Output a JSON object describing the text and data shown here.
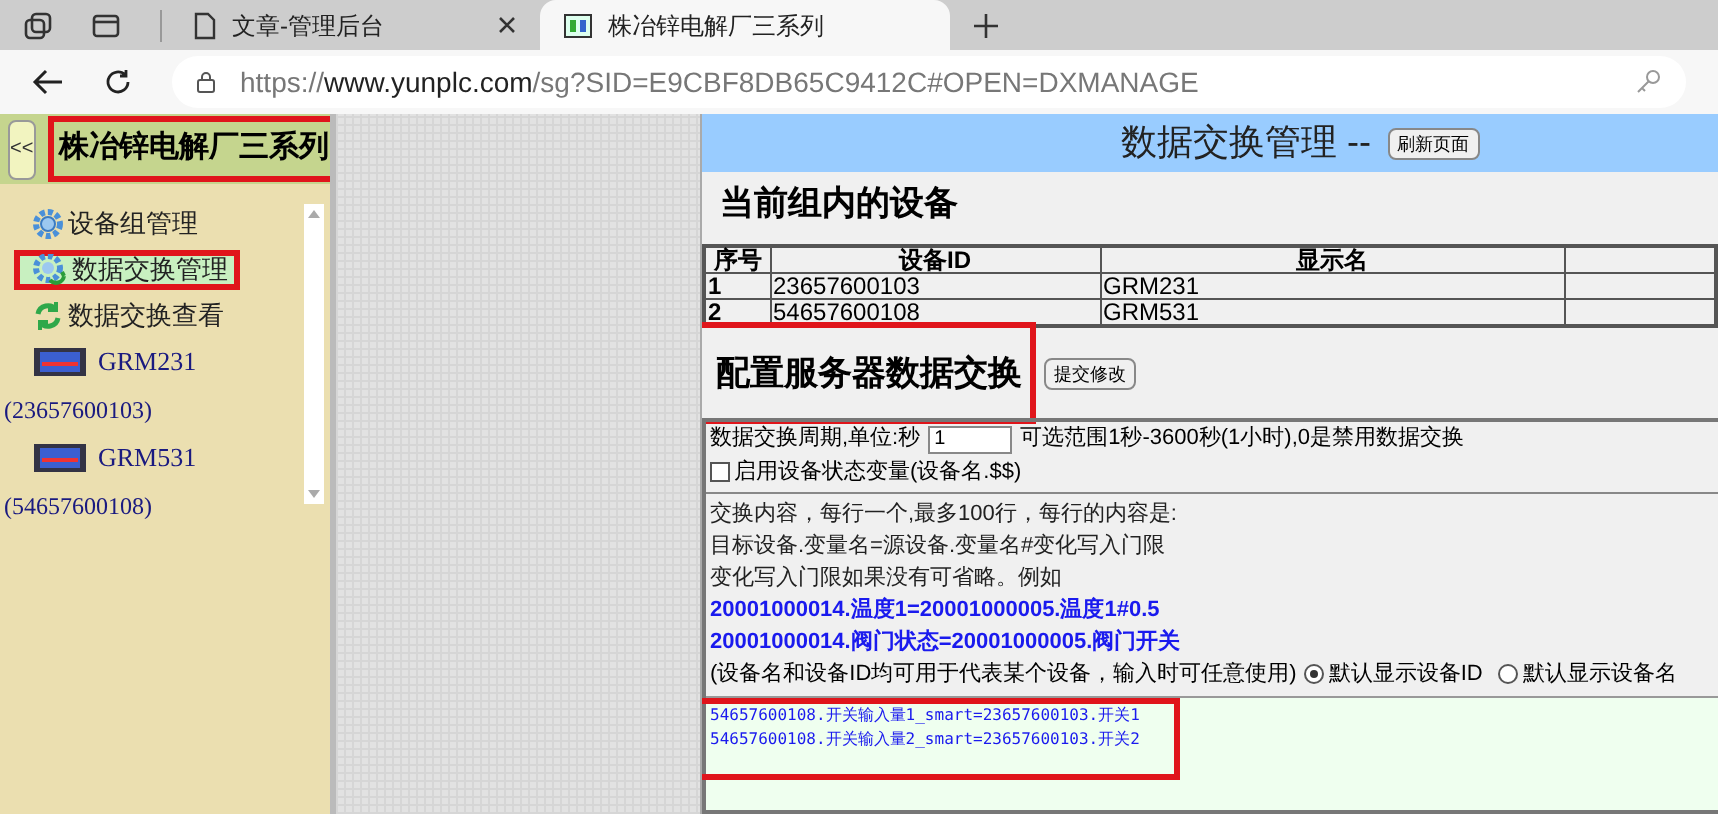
{
  "browser": {
    "tabs": [
      {
        "title": "文章-管理后台",
        "selected": false
      },
      {
        "title": "株冶锌电解厂三系列",
        "selected": true
      }
    ],
    "url_scheme": "https://",
    "url_host": "www.yunplc.com",
    "url_path": "/sg?SID=E9CBF8DB65C9412C#OPEN=DXMANAGE"
  },
  "sidebar": {
    "collapse_button": "<<",
    "title": "株冶锌电解厂三系列",
    "title_highlighted": true,
    "items": [
      {
        "kind": "gear",
        "label": "设备组管理",
        "selected": false,
        "highlighted": false
      },
      {
        "kind": "gear-sync",
        "label": "数据交换管理",
        "selected": true,
        "highlighted": true
      },
      {
        "kind": "sync",
        "label": "数据交换查看",
        "selected": false,
        "highlighted": false
      },
      {
        "kind": "device",
        "label": "GRM231",
        "sublabel": "(23657600103)",
        "selected": false,
        "highlighted": false
      },
      {
        "kind": "device",
        "label": "GRM531",
        "sublabel": "(54657600108)",
        "selected": false,
        "highlighted": false
      }
    ]
  },
  "main": {
    "title": "数据交换管理 --",
    "refresh_button": "刷新页面",
    "devices_heading": "当前组内的设备",
    "table": {
      "columns": [
        "序号",
        "设备ID",
        "显示名"
      ],
      "rows": [
        [
          "1",
          "23657600103",
          "GRM231"
        ],
        [
          "2",
          "54657600108",
          "GRM531"
        ]
      ]
    },
    "config_heading": "配置服务器数据交换",
    "config_heading_highlighted": true,
    "submit_button": "提交修改",
    "period_label": "数据交换周期,单位:秒",
    "period_value": "1",
    "period_hint": "可选范围1秒-3600秒(1小时),0是禁用数据交换",
    "status_var": {
      "label": "启用设备状态变量(设备名.$$)",
      "checked": false
    },
    "help_lines": [
      "交换内容，每行一个,最多100行，每行的内容是:",
      "目标设备.变量名=源设备.变量名#变化写入门限",
      "变化写入门限如果没有可省略。例如"
    ],
    "examples": [
      "20001000014.温度1=20001000005.温度1#0.5",
      "20001000014.阀门状态=20001000005.阀门开关"
    ],
    "note": "(设备名和设备ID均可用于代表某个设备，输入时可任意使用)",
    "display_options": [
      {
        "label": "默认显示设备ID",
        "selected": true
      },
      {
        "label": "默认显示设备名",
        "selected": false
      }
    ],
    "exchange_lines": [
      "54657600108.开关输入量1_smart=23657600103.开关1",
      "54657600108.开关输入量2_smart=23657600103.开关2"
    ],
    "exchange_highlighted": true
  }
}
